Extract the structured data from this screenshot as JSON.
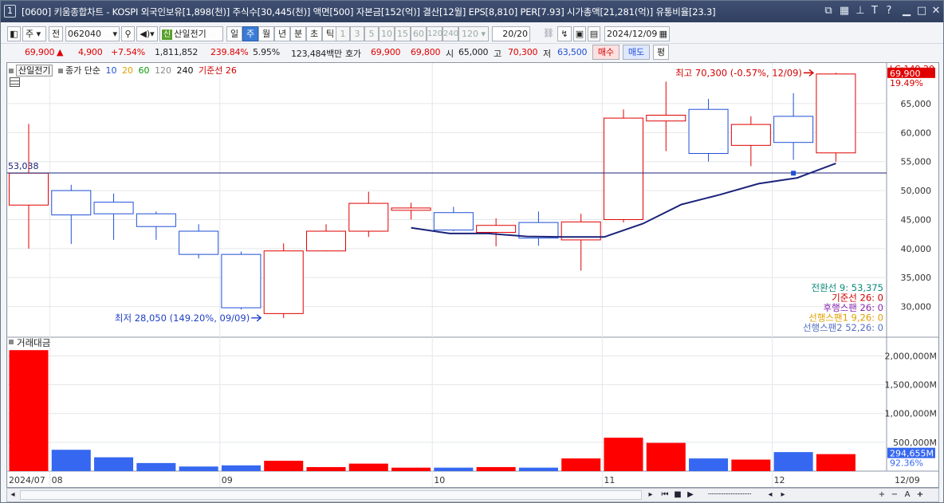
{
  "titlebar": {
    "number": "1",
    "title": "[0600] 키움종합차트 - KOSPI 외국인보유[1,898(천)] 주식수[30,445(천)] 액면[500] 자본금[152(억)] 결산[12월] EPS[8,810] PER[7.93] 시가총액[21,281(억)] 유통비율[23.3]"
  },
  "toolbar": {
    "market_type": "주",
    "market_type2": "전",
    "code": "062040",
    "stock_badge": "신",
    "stock_name": "산일전기",
    "periods": [
      "일",
      "주",
      "월",
      "년",
      "분",
      "초",
      "틱"
    ],
    "active_period": "주",
    "intervals": [
      "1",
      "3",
      "5",
      "10",
      "15",
      "60",
      "120",
      "240"
    ],
    "interval_value": "120",
    "count": "20",
    "count_total": "/20",
    "date": "2024/12/09"
  },
  "quote": {
    "price": "69,900",
    "arrow": "▲",
    "change": "4,900",
    "change_pct": "+7.54%",
    "volume": "1,811,852",
    "vol_ratio": "239.84%",
    "turnover": "5.95%",
    "amount": "123,484백만",
    "hoga_label": "호가",
    "ask": "69,900",
    "bid": "69,800",
    "open_label": "시",
    "open": "65,000",
    "high_label": "고",
    "high": "70,300",
    "low_label": "저",
    "low": "63,500",
    "buy_label": "매수",
    "sell_label": "매도",
    "eval_label": "평"
  },
  "legend": {
    "name": "산일전기",
    "indicator": "종가 단순",
    "ma": [
      {
        "label": "10",
        "color": "#1f4fd6"
      },
      {
        "label": "20",
        "color": "#e0a000"
      },
      {
        "label": "60",
        "color": "#0a9a0a"
      },
      {
        "label": "120",
        "color": "#888888"
      },
      {
        "label": "240",
        "color": "#111111"
      }
    ],
    "base_line": "기준선 26"
  },
  "chart_data": {
    "type": "candlestick",
    "price_axis": {
      "min": 25000,
      "max": 72000,
      "ticks": [
        30000,
        35000,
        40000,
        45000,
        50000,
        55000,
        60000,
        65000
      ]
    },
    "candles": [
      {
        "o": 47500,
        "h": 61500,
        "l": 40000,
        "c": 53000
      },
      {
        "o": 50000,
        "h": 51000,
        "l": 40800,
        "c": 45800
      },
      {
        "o": 48000,
        "h": 49500,
        "l": 41500,
        "c": 46000
      },
      {
        "o": 46000,
        "h": 46400,
        "l": 41500,
        "c": 43800
      },
      {
        "o": 43000,
        "h": 44200,
        "l": 38300,
        "c": 39000
      },
      {
        "o": 39000,
        "h": 39500,
        "l": 29500,
        "c": 29800
      },
      {
        "o": 28800,
        "h": 40900,
        "l": 28050,
        "c": 39600
      },
      {
        "o": 39600,
        "h": 44200,
        "l": 39500,
        "c": 43000
      },
      {
        "o": 43000,
        "h": 49800,
        "l": 42000,
        "c": 47800
      },
      {
        "o": 46600,
        "h": 47900,
        "l": 45000,
        "c": 47000
      },
      {
        "o": 46200,
        "h": 47200,
        "l": 43000,
        "c": 43200
      },
      {
        "o": 42800,
        "h": 45200,
        "l": 40400,
        "c": 44000
      },
      {
        "o": 44500,
        "h": 46400,
        "l": 40500,
        "c": 41800
      },
      {
        "o": 41500,
        "h": 46000,
        "l": 36200,
        "c": 44600
      },
      {
        "o": 45000,
        "h": 64000,
        "l": 44500,
        "c": 62500
      },
      {
        "o": 62000,
        "h": 68800,
        "l": 56800,
        "c": 63000
      },
      {
        "o": 64000,
        "h": 65800,
        "l": 55000,
        "c": 56400
      },
      {
        "o": 57800,
        "h": 62800,
        "l": 54200,
        "c": 61400
      },
      {
        "o": 62800,
        "h": 66800,
        "l": 55300,
        "c": 58300
      },
      {
        "o": 56500,
        "h": 70300,
        "l": 55000,
        "c": 70100
      }
    ],
    "line_values": [
      43600,
      42600,
      42600,
      42100,
      42000,
      42000,
      44300,
      47600,
      49300,
      51200,
      52200,
      54700
    ],
    "line_start_index": 9,
    "marker": {
      "index": 18,
      "value": 53000
    },
    "hline": {
      "value": 53038,
      "label": "53,038"
    },
    "high_annot": "최고 70,300 (-0.57%, 12/09)",
    "low_annot": "최저 28,050 (149.20%, 09/09)",
    "price_box": "69,900",
    "lc_label": "LC:149.20",
    "pct_label": "19.49%",
    "indicators": [
      {
        "text": "전환선 9: 53,375",
        "color": "#0a8a7a"
      },
      {
        "text": "기준선 26: 0",
        "color": "#d00000"
      },
      {
        "text": "후행스팬 26: 0",
        "color": "#8a2ab0"
      },
      {
        "text": "선행스팬1 9,26: 0",
        "color": "#e0a000"
      },
      {
        "text": "선행스팬2 52,26: 0",
        "color": "#5570c0"
      }
    ],
    "volume_label": "거래대금",
    "volume_axis": {
      "max": 2200,
      "ticks": [
        {
          "v": 500,
          "t": "500,000M"
        },
        {
          "v": 1000,
          "t": "1,000,000M"
        },
        {
          "v": 1500,
          "t": "1,500,000M"
        },
        {
          "v": 2000,
          "t": "2,000,000M"
        }
      ]
    },
    "volumes": [
      2100,
      370,
      240,
      140,
      80,
      100,
      180,
      70,
      130,
      60,
      60,
      70,
      60,
      220,
      580,
      490,
      220,
      200,
      330,
      295
    ],
    "vol_box": "294,655M",
    "vol_pct": "92.36%",
    "x_labels": [
      {
        "index": 0,
        "text": "2024/07"
      },
      {
        "index": 1,
        "text": "08"
      },
      {
        "index": 5,
        "text": "09"
      },
      {
        "index": 10,
        "text": "10"
      },
      {
        "index": 14,
        "text": "11"
      },
      {
        "index": 18,
        "text": "12"
      }
    ],
    "last_date": "12/09",
    "colors": {
      "up": "#e00000",
      "down": "#1f4fd6",
      "line": "#1c237a",
      "hline": "#1c237a",
      "vol_up": "#ff0000",
      "vol_down": "#3567f0"
    }
  },
  "bottom": {
    "plus": "+",
    "minus": "−",
    "zoom": "A"
  }
}
